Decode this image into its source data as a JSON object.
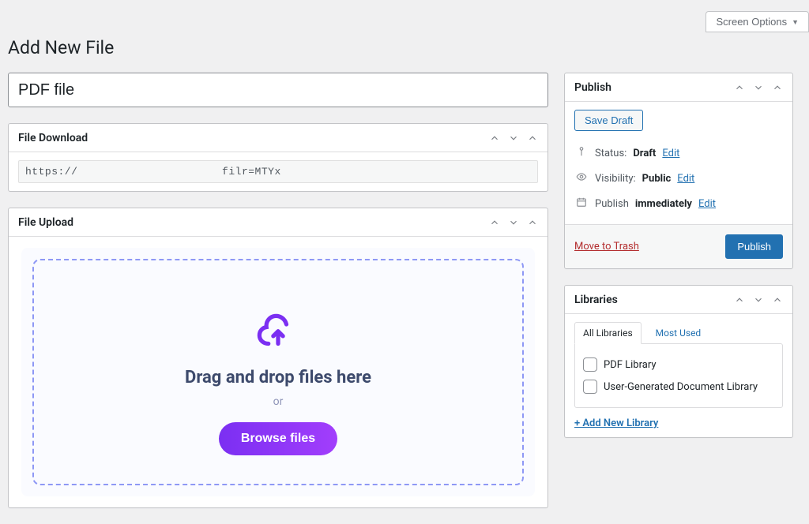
{
  "screen_options_label": "Screen Options",
  "page_title": "Add New File",
  "post_title_value": "PDF file",
  "file_download": {
    "heading": "File Download",
    "url": "https://                      filr=MTYx"
  },
  "file_upload": {
    "heading": "File Upload",
    "drag_text": "Drag and drop files here",
    "or_text": "or",
    "browse_label": "Browse files"
  },
  "publish": {
    "heading": "Publish",
    "save_draft_label": "Save Draft",
    "status_label": "Status:",
    "status_value": "Draft",
    "visibility_label": "Visibility:",
    "visibility_value": "Public",
    "publish_label": "Publish",
    "publish_value": "immediately",
    "edit_label": "Edit",
    "trash_label": "Move to Trash",
    "publish_button": "Publish"
  },
  "libraries": {
    "heading": "Libraries",
    "tab_all": "All Libraries",
    "tab_most": "Most Used",
    "items": [
      {
        "label": "PDF Library"
      },
      {
        "label": "User-Generated Document Library"
      }
    ],
    "add_new_label": "+ Add New Library"
  }
}
